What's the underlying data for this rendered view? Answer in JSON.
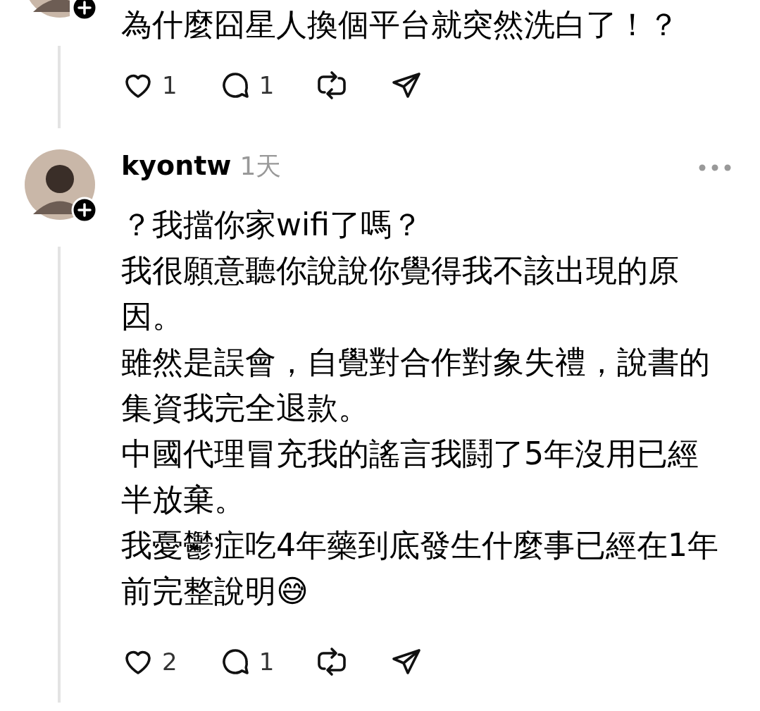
{
  "posts": [
    {
      "kind": "cut-off",
      "paragraphs": [
        "為什麼囧星人換個平台就突然洗白了！？"
      ],
      "likes": "1",
      "replies": "1"
    },
    {
      "kind": "full",
      "username": "kyontw",
      "time": "1天",
      "paragraphs": [
        "？我擋你家wifi了嗎？",
        "我很願意聽你說說你覺得我不該出現的原因。",
        "雖然是誤會，自覺對合作對象失禮，說書的集資我完全退款。",
        "中國代理冒充我的謠言我鬪了5年沒用已經半放棄。",
        "我憂鬱症吃4年藥到底發生什麼事已經在1年前完整說明😅"
      ],
      "likes": "2",
      "replies": "1"
    }
  ]
}
